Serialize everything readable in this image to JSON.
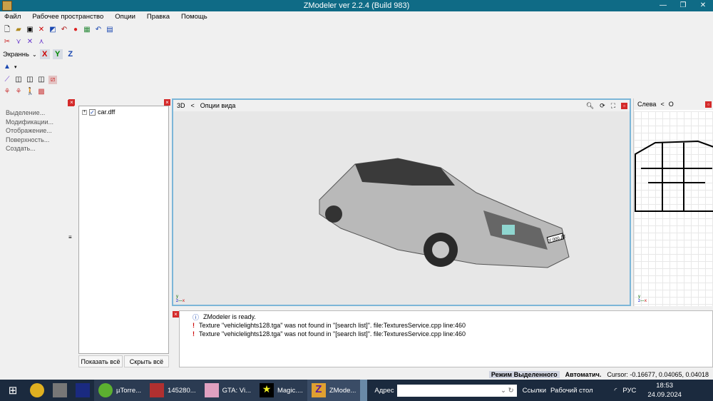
{
  "window": {
    "title": "ZModeler ver 2.2.4 (Build 983)"
  },
  "menu": [
    "Файл",
    "Рабочее пространство",
    "Опции",
    "Правка",
    "Помощь"
  ],
  "toolbar": {
    "view_select": "Экраннь",
    "axes": [
      "X",
      "Y",
      "Z"
    ]
  },
  "left_panel": {
    "items": [
      "Выделение...",
      "Модификации...",
      "Отображение...",
      "Поверхность...",
      "Создать..."
    ]
  },
  "tree": {
    "items": [
      {
        "label": "car.dff",
        "checked": true
      }
    ],
    "show_all": "Показать всё",
    "hide_all": "Скрыть всё"
  },
  "viewport3d": {
    "label": "3D",
    "options": "Опции вида",
    "plate": "У 000 ДТ"
  },
  "viewport_left": {
    "label": "Слева",
    "options": "О"
  },
  "log": {
    "lines": [
      {
        "type": "info",
        "text": "ZModeler is ready."
      },
      {
        "type": "warning",
        "text": "Texture \"vehiclelights128.tga\" was not found in \"[search list]\". file:TexturesService.cpp line:460"
      },
      {
        "type": "warning",
        "text": "Texture \"vehiclelights128.tga\" was not found in \"[search list]\". file:TexturesService.cpp line:460"
      }
    ]
  },
  "status": {
    "mode": "Режим Выделенного",
    "auto": "Автоматич.",
    "cursor": "Cursor: -0.16677, 0.04065, 0.04018"
  },
  "taskbar": {
    "apps": [
      "µTorre...",
      "145280...",
      "GTA: Vi...",
      "Magic....",
      "ZMode..."
    ],
    "address_label": "Адрес",
    "links": "Ссылки",
    "desktop": "Рабочий стол",
    "lang": "РУС",
    "time": "18:53",
    "date": "24.09.2024"
  }
}
